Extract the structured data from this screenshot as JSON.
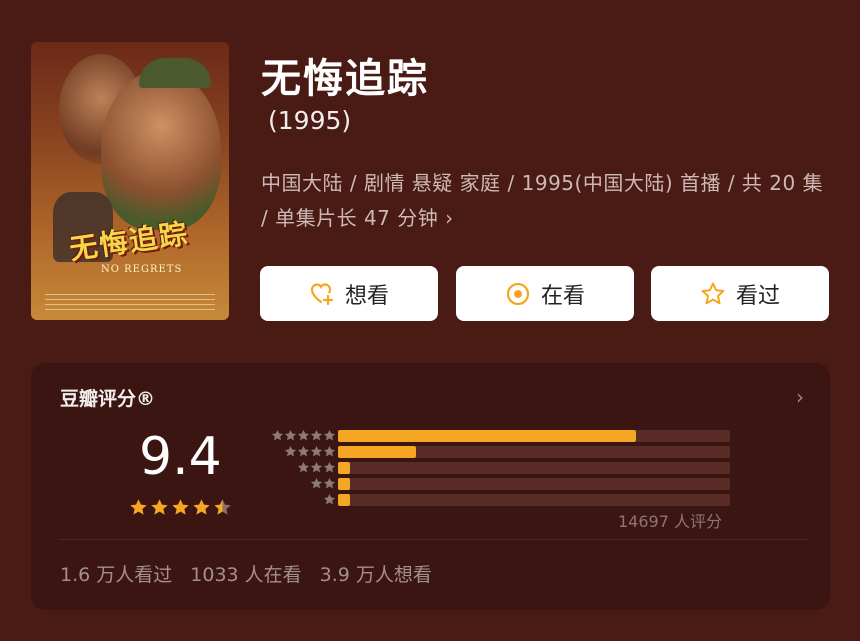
{
  "movie": {
    "title": "无悔追踪",
    "year": "(1995)",
    "meta_line": "中国大陆 / 剧情 悬疑 家庭 / 1995(中国大陆) 首播 / 共 20 集 / 单集片长 47 分钟",
    "poster": {
      "title_text": "无悔追踪",
      "subtitle_text": "NO REGRETS"
    }
  },
  "actions": {
    "want": "想看",
    "watching": "在看",
    "watched": "看过"
  },
  "rating": {
    "label": "豆瓣评分®",
    "score": "9.4",
    "stars_value": 4.5,
    "distribution": [
      {
        "stars": 5,
        "fraction": 0.76
      },
      {
        "stars": 4,
        "fraction": 0.2
      },
      {
        "stars": 3,
        "fraction": 0.03
      },
      {
        "stars": 2,
        "fraction": 0.02
      },
      {
        "stars": 1,
        "fraction": 0.02
      }
    ],
    "count_text": "14697 人评分",
    "accent_color": "#f5a623"
  },
  "stats": {
    "watched": "1.6 万人看过",
    "watching": "1033 人在看",
    "want": "3.9 万人想看"
  }
}
